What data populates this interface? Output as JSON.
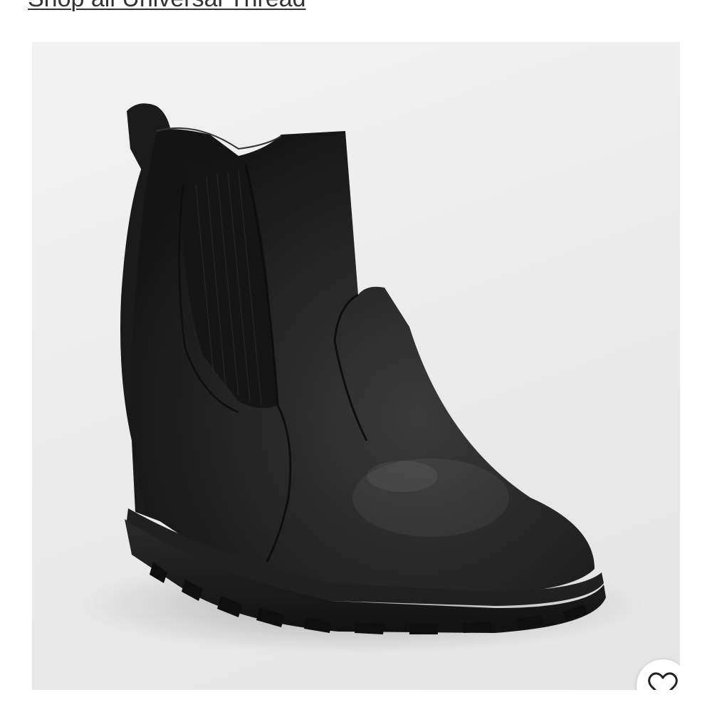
{
  "header": {
    "shop_link_label": "Shop all Universal Thread"
  },
  "product": {
    "image_icon": "ankle-wedge-boot-image"
  },
  "actions": {
    "favorite_icon": "heart-outline-icon"
  },
  "colors": {
    "background": "#ffffff",
    "image_background": "#ececec",
    "boot": "#1f1f1f"
  }
}
